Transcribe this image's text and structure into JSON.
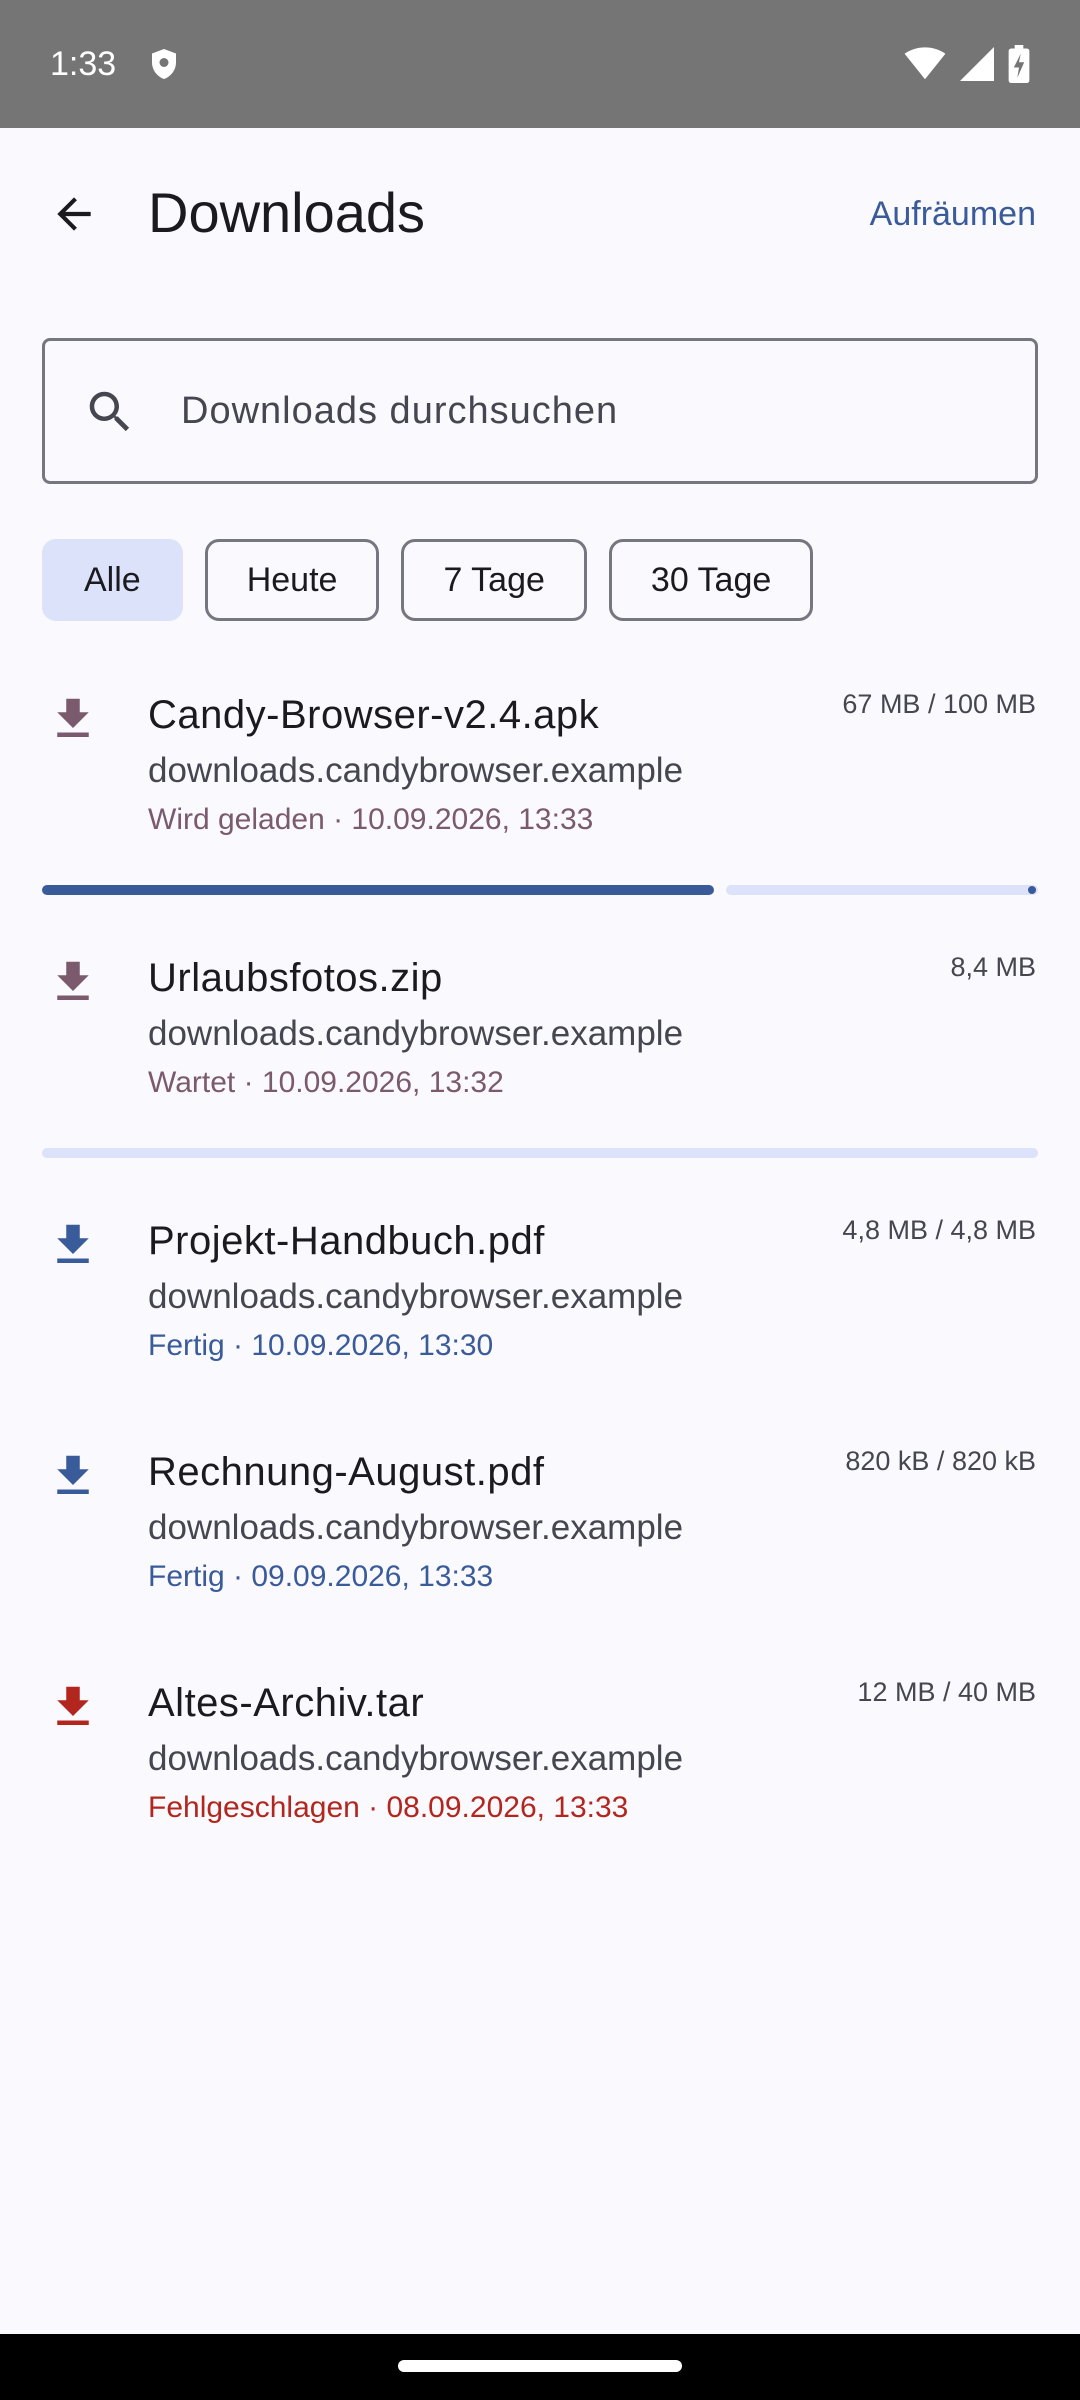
{
  "status_bar": {
    "time": "1:33",
    "icons": [
      "shield-icon",
      "wifi-icon",
      "signal-icon",
      "battery-charging-icon"
    ]
  },
  "app_bar": {
    "back_icon": "arrow-back-icon",
    "title": "Downloads",
    "action_label": "Aufräumen"
  },
  "search": {
    "placeholder": "Downloads durchsuchen",
    "value": "",
    "icon": "search-icon"
  },
  "filters": [
    {
      "label": "Alle",
      "selected": true
    },
    {
      "label": "Heute",
      "selected": false
    },
    {
      "label": "7 Tage",
      "selected": false
    },
    {
      "label": "30 Tage",
      "selected": false
    }
  ],
  "downloads": [
    {
      "name": "Candy-Browser-v2.4.apk",
      "domain": "downloads.candybrowser.example",
      "status": "Wird geladen · 10.09.2026, 13:33",
      "size": "67 MB / 100 MB",
      "state": "loading",
      "progress": 0.67,
      "icon": "download-icon"
    },
    {
      "name": "Urlaubsfotos.zip",
      "domain": "downloads.candybrowser.example",
      "status": "Wartet · 10.09.2026, 13:32",
      "size": "8,4 MB",
      "state": "waiting",
      "progress": 0,
      "icon": "download-icon"
    },
    {
      "name": "Projekt-Handbuch.pdf",
      "domain": "downloads.candybrowser.example",
      "status": "Fertig · 10.09.2026, 13:30",
      "size": "4,8 MB / 4,8 MB",
      "state": "done",
      "icon": "download-icon"
    },
    {
      "name": "Rechnung-August.pdf",
      "domain": "downloads.candybrowser.example",
      "status": "Fertig · 09.09.2026, 13:33",
      "size": "820 kB / 820 kB",
      "state": "done",
      "icon": "download-icon"
    },
    {
      "name": "Altes-Archiv.tar",
      "domain": "downloads.candybrowser.example",
      "status": "Fehlgeschlagen · 08.09.2026, 13:33",
      "size": "12 MB / 40 MB",
      "state": "failed",
      "icon": "download-icon"
    }
  ],
  "colors": {
    "accent": "#3A5B9A",
    "loading": "#7A5A6C",
    "failed": "#B3261E",
    "chip_selected": "#DBE2F9"
  }
}
